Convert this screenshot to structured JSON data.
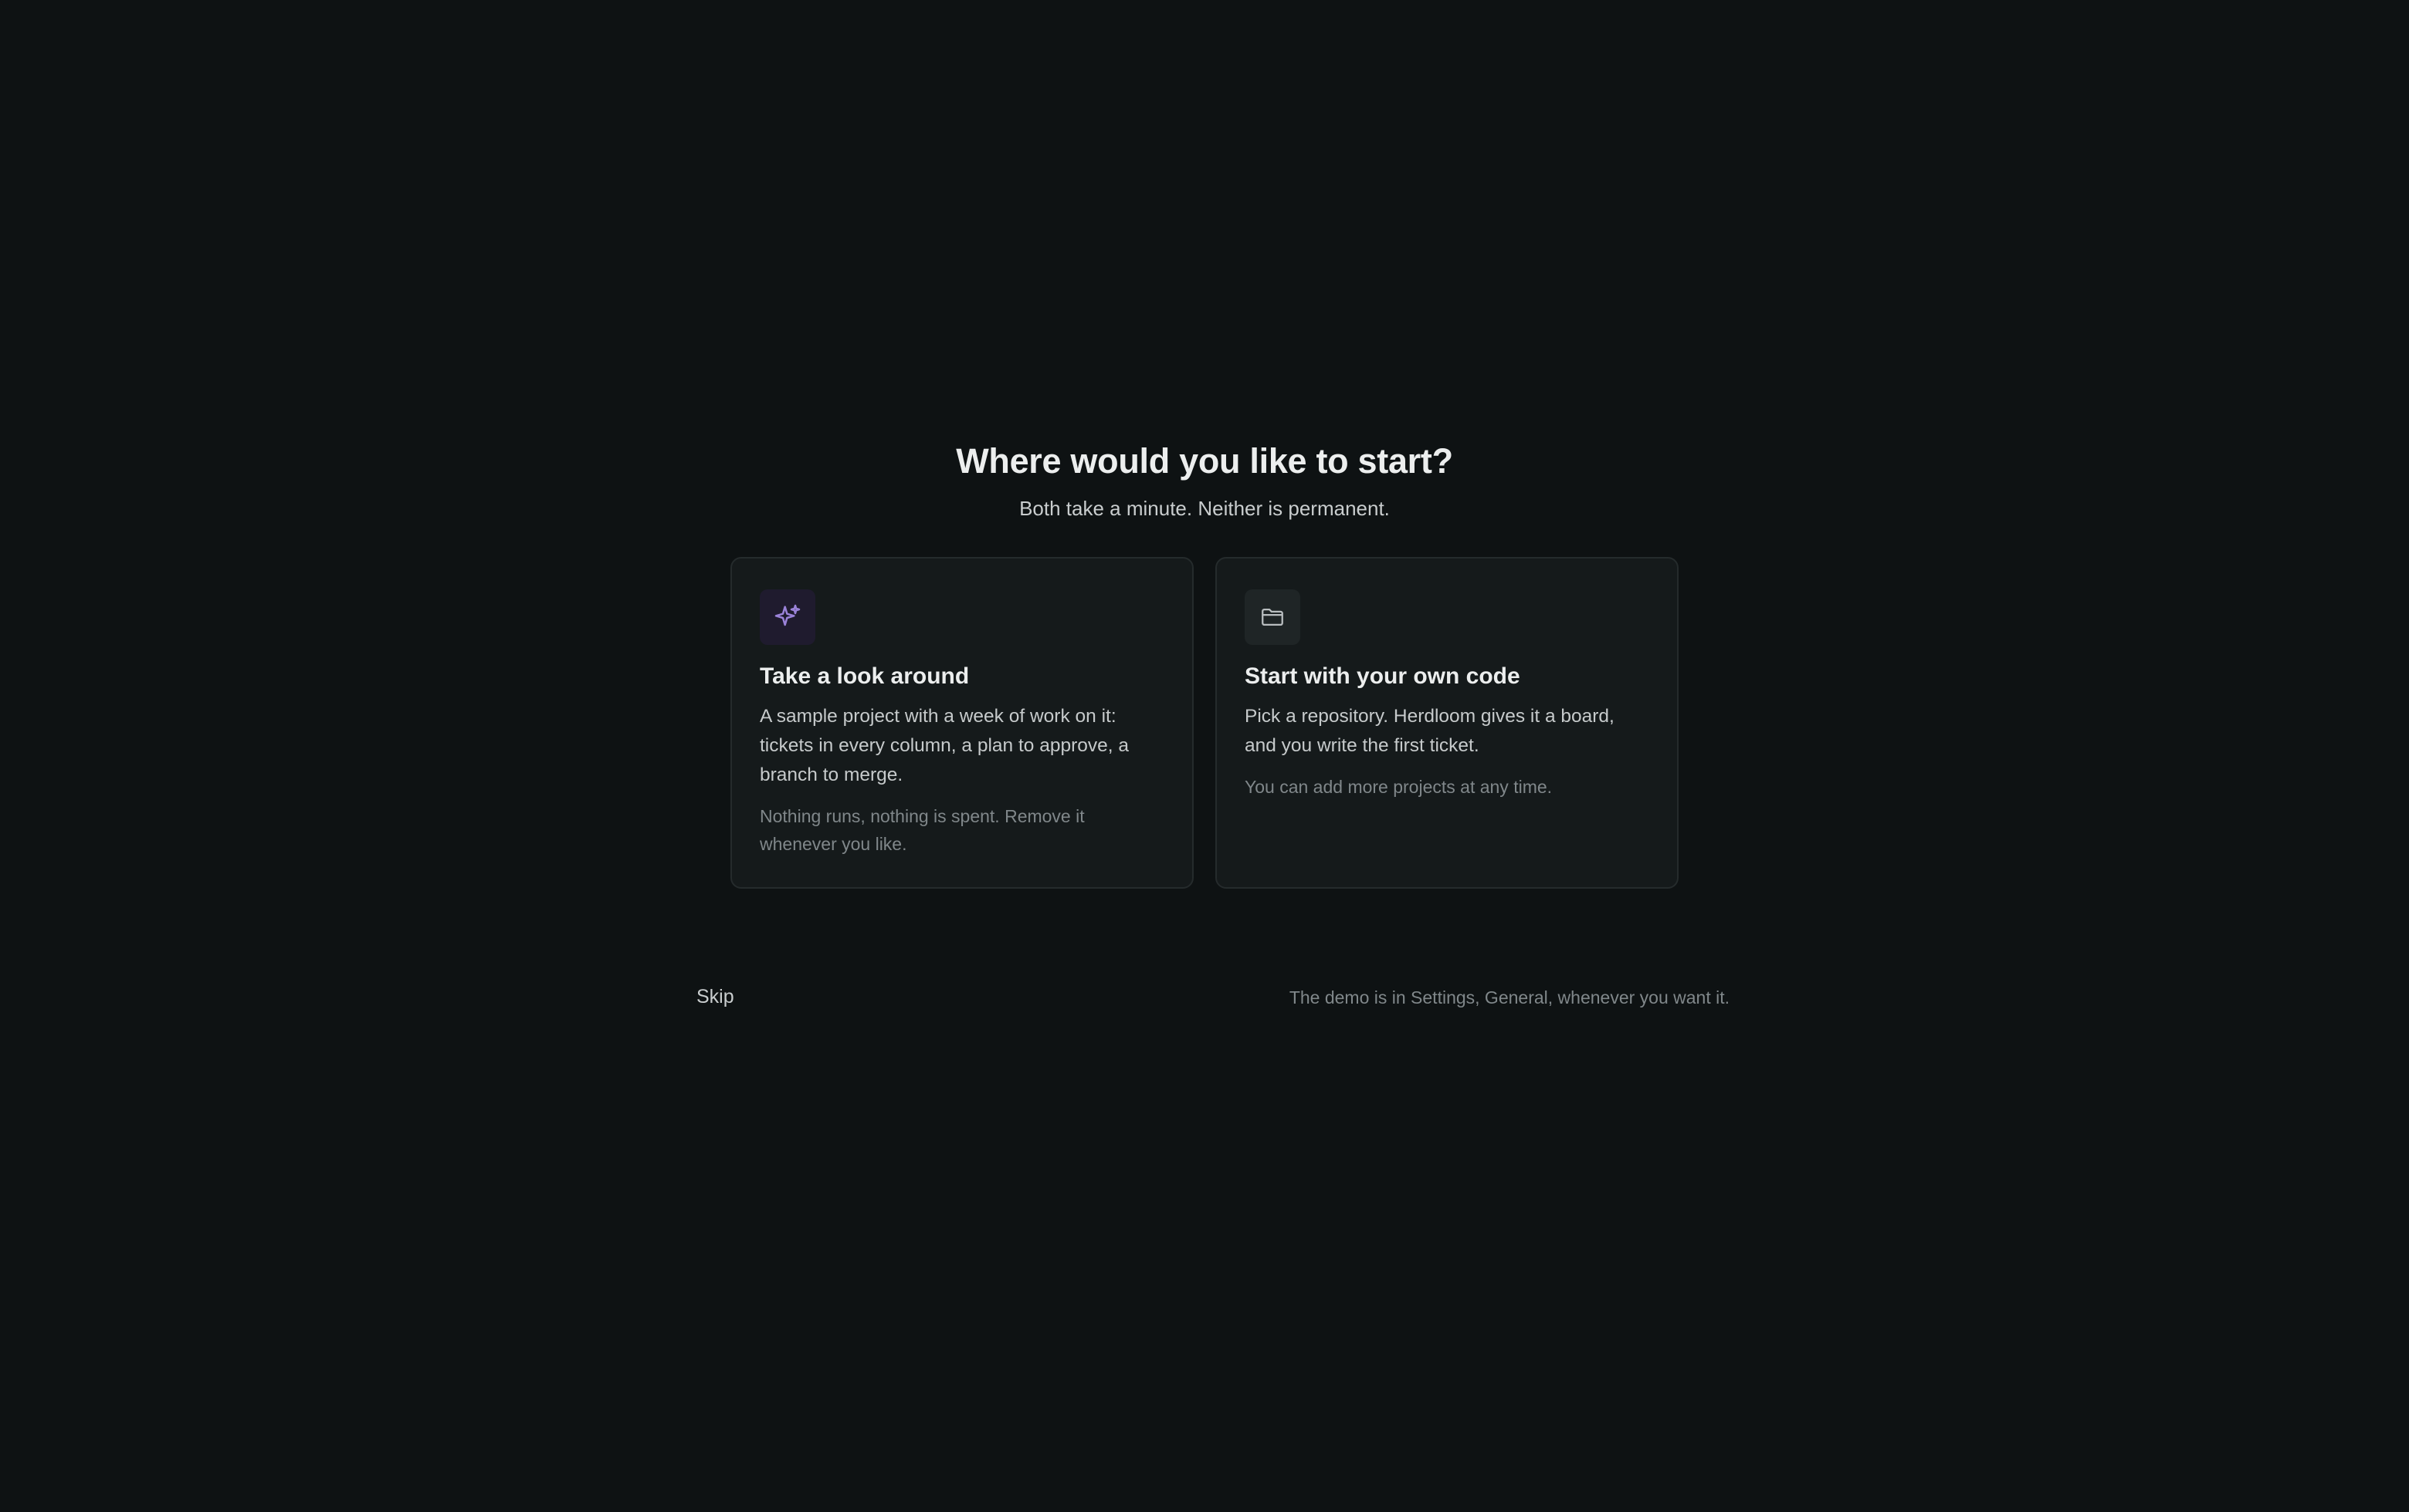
{
  "header": {
    "title": "Where would you like to start?",
    "subtitle": "Both take a minute. Neither is permanent."
  },
  "options": [
    {
      "icon": "sparkle-icon",
      "icon_color": "#9a82d8",
      "title": "Take a look around",
      "description": "A sample project with a week of work on it: tickets in every column, a plan to approve, a branch to merge.",
      "note": "Nothing runs, nothing is spent. Remove it whenever you like."
    },
    {
      "icon": "folder-icon",
      "icon_color": "#b9bec0",
      "title": "Start with your own code",
      "description": "Pick a repository. Herdloom gives it a board, and you write the first ticket.",
      "note": "You can add more projects at any time."
    }
  ],
  "footer": {
    "skip_label": "Skip",
    "hint": "The demo is in Settings, General, whenever you want it."
  }
}
